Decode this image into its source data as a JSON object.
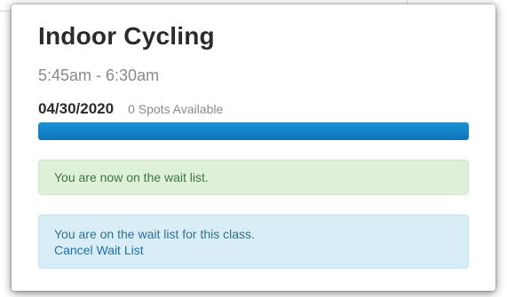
{
  "class_card": {
    "title": "Indoor Cycling",
    "time_range": "5:45am - 6:30am",
    "date": "04/30/2020",
    "spots_available": "0 Spots Available",
    "capacity_fill_fraction": 1.0,
    "progress_color": "#1285cc"
  },
  "alerts": {
    "success_message": "You are now on the wait list.",
    "info_message": "You are on the wait list for this class.",
    "cancel_link_label": "Cancel Wait List"
  },
  "colors": {
    "success_bg": "#dff0d8",
    "info_bg": "#d9edf7"
  }
}
